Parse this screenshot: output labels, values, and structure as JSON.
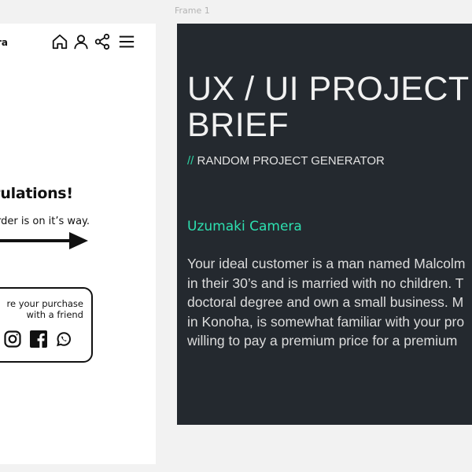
{
  "canvas": {
    "frame_label": "Frame 1",
    "background": "#f2f2f2"
  },
  "mobile_screen": {
    "brand": "ra",
    "header_icons": [
      "home-icon",
      "user-icon",
      "share-icon",
      "hamburger-menu-icon"
    ],
    "congrats_heading": "ratulations!",
    "order_message": "rder is on it’s way.",
    "arrow_icon": "right-arrow-icon",
    "share_box": {
      "line1": "re your purchase",
      "line2": "with a friend",
      "social_icons": [
        "instagram-icon",
        "facebook-icon",
        "whatsapp-icon"
      ]
    }
  },
  "brief": {
    "background": "#24292f",
    "accent": "#2de0b0",
    "title_line1": "UX / UI PROJECT",
    "title_line2": "BRIEF",
    "subtitle_prefix": "//",
    "subtitle": "RANDOM PROJECT GENERATOR",
    "company": "Uzumaki Camera",
    "description_lines": [
      "Your ideal customer is a man named Malcolm",
      "in their 30’s and is married with no children. T",
      "doctoral degree and own a small business. M",
      "in Konoha, is somewhat familiar with your pro",
      "willing to pay a premium price for a premium"
    ]
  }
}
